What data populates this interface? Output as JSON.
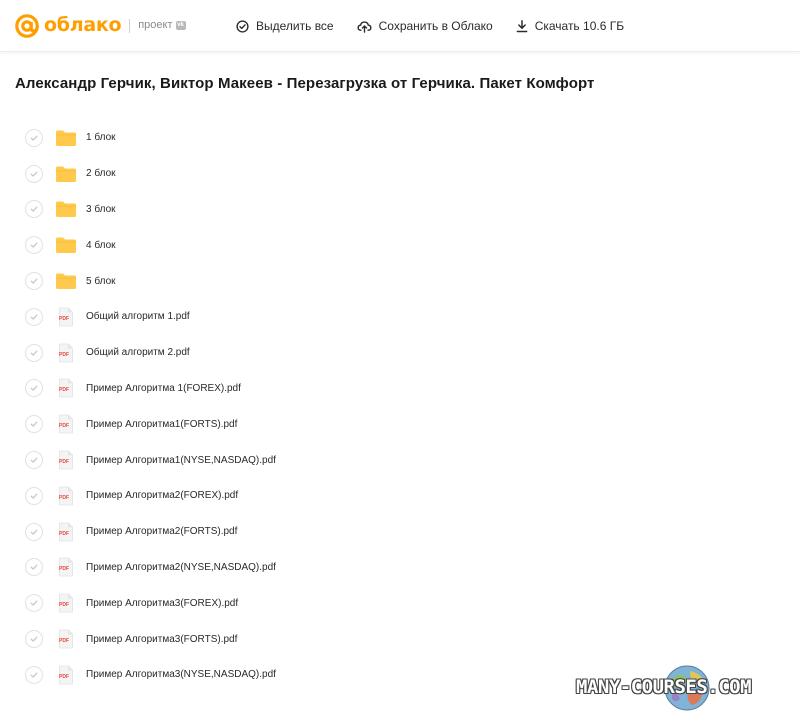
{
  "brand": {
    "name": "облако",
    "project_label": "проект",
    "badge": "vk",
    "accent_color": "#ff9e00"
  },
  "toolbar": {
    "select_all_label": "Выделить все",
    "select_all_icon": "check-circle-icon",
    "save_label": "Сохранить в Облако",
    "save_icon": "cloud-upload-icon",
    "download_label": "Скачать 10.6 ГБ",
    "download_icon": "download-icon"
  },
  "folder_title": "Александр Герчик, Виктор Макеев - Перезагрузка от Герчика. Пакет Комфорт",
  "items": [
    {
      "type": "folder",
      "name": "1 блок"
    },
    {
      "type": "folder",
      "name": "2 блок"
    },
    {
      "type": "folder",
      "name": "3 блок"
    },
    {
      "type": "folder",
      "name": "4 блок"
    },
    {
      "type": "folder",
      "name": "5 блок"
    },
    {
      "type": "pdf",
      "name": "Общий алгоритм 1.pdf"
    },
    {
      "type": "pdf",
      "name": "Общий алгоритм 2.pdf"
    },
    {
      "type": "pdf",
      "name": "Пример Алгоритма 1(FOREX).pdf"
    },
    {
      "type": "pdf",
      "name": "Пример Алгоритма1(FORTS).pdf"
    },
    {
      "type": "pdf",
      "name": "Пример Алгоритма1(NYSE,NASDAQ).pdf"
    },
    {
      "type": "pdf",
      "name": "Пример Алгоритма2(FOREX).pdf"
    },
    {
      "type": "pdf",
      "name": "Пример Алгоритма2(FORTS).pdf"
    },
    {
      "type": "pdf",
      "name": "Пример Алгоритма2(NYSE,NASDAQ).pdf"
    },
    {
      "type": "pdf",
      "name": "Пример Алгоритма3(FOREX).pdf"
    },
    {
      "type": "pdf",
      "name": "Пример Алгоритма3(FORTS).pdf"
    },
    {
      "type": "pdf",
      "name": "Пример Алгоритма3(NYSE,NASDAQ).pdf"
    }
  ],
  "pdf_badge": "PDF",
  "colors": {
    "folder": "#ffc94d",
    "pdf_badge": "#e8453c",
    "checkbox_border": "#e2e2e2"
  },
  "watermark": {
    "text": "MANY-COURSES.COM"
  }
}
